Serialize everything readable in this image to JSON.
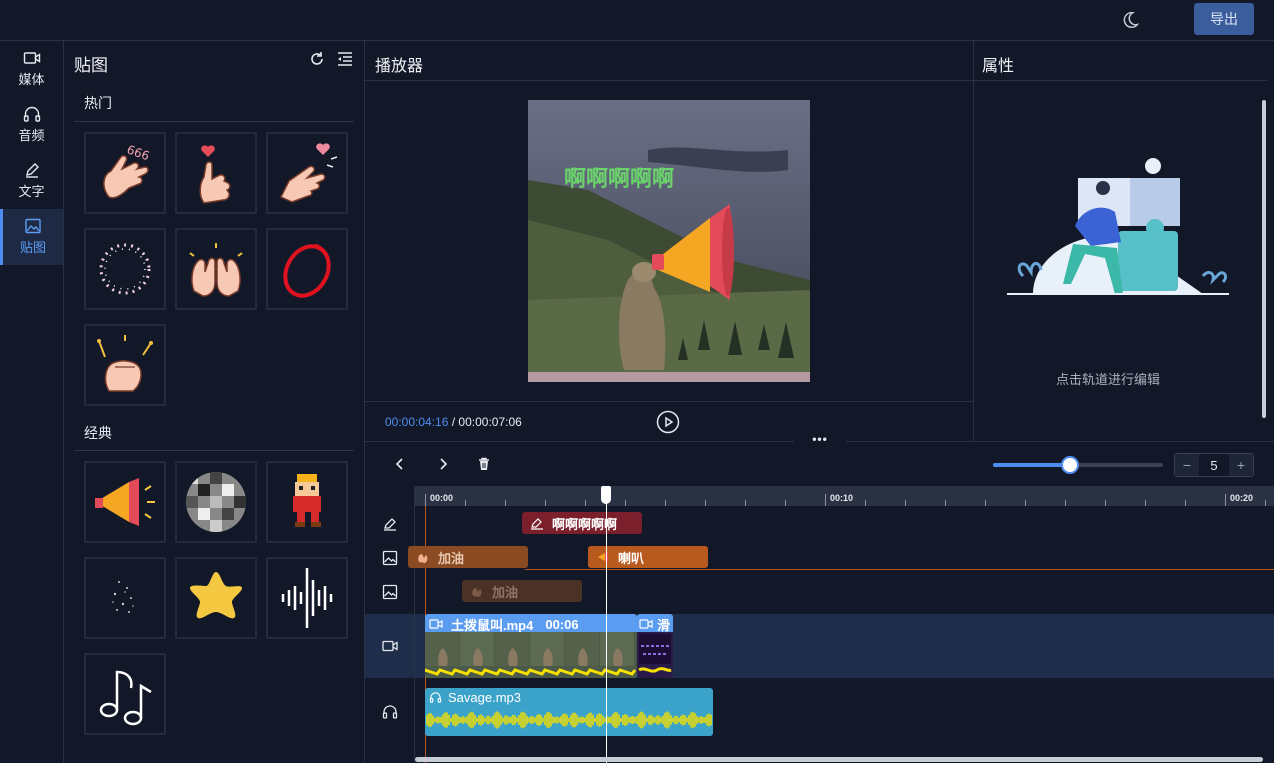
{
  "topbar": {
    "export_label": "导出"
  },
  "nav": {
    "items": [
      {
        "label": "媒体",
        "icon": "video-icon"
      },
      {
        "label": "音频",
        "icon": "headphones-icon"
      },
      {
        "label": "文字",
        "icon": "pen-icon"
      },
      {
        "label": "贴图",
        "icon": "image-icon"
      }
    ],
    "active_index": 3,
    "active_color": "#5c9cf5"
  },
  "stickers": {
    "title": "贴图",
    "sections": [
      {
        "title": "热门",
        "items": [
          "hand-666-sticker",
          "finger-heart-sticker",
          "heart-fingers-sticker",
          "sparkle-circle-sticker",
          "clapping-hands-sticker",
          "red-circle-sticker",
          "fist-stars-sticker"
        ]
      },
      {
        "title": "经典",
        "items": [
          "megaphone-sticker",
          "mosaic-sticker",
          "pixel-character-sticker",
          "sparkle-dust-sticker",
          "yellow-star-sticker",
          "sound-wave-sticker",
          "music-note-sticker"
        ]
      }
    ]
  },
  "player": {
    "title": "播放器",
    "overlay_text": "啊啊啊啊啊",
    "timecode_current": "00:00:04:16",
    "timecode_separator": " / ",
    "timecode_total": "00:00:07:06"
  },
  "props": {
    "title": "属性",
    "hint": "点击轨道进行编辑"
  },
  "timeline": {
    "more_label": "•••",
    "zoom": {
      "value": 0.45,
      "level": "5",
      "minus": "−",
      "plus": "+"
    },
    "ruler_labels": [
      "00:00",
      "00:10",
      "00:20"
    ],
    "tracks": {
      "text_clip": {
        "label": "啊啊啊啊啊",
        "color": "#7a1f2b"
      },
      "sticker_clip_1": {
        "label": "加油",
        "color": "#8a4a22"
      },
      "sticker_clip_2": {
        "label": "喇叭",
        "color": "#b8591e"
      },
      "sticker_clip_3": {
        "label": "加油",
        "color": "#4a3226"
      },
      "video_clip_1": {
        "label": "土拨鼠叫.mp4",
        "duration": "00:06",
        "color": "#5a9cf0"
      },
      "video_clip_2": {
        "label": "滑"
      },
      "audio_clip": {
        "label": "Savage.mp3",
        "color": "#3ba3c9"
      }
    }
  }
}
